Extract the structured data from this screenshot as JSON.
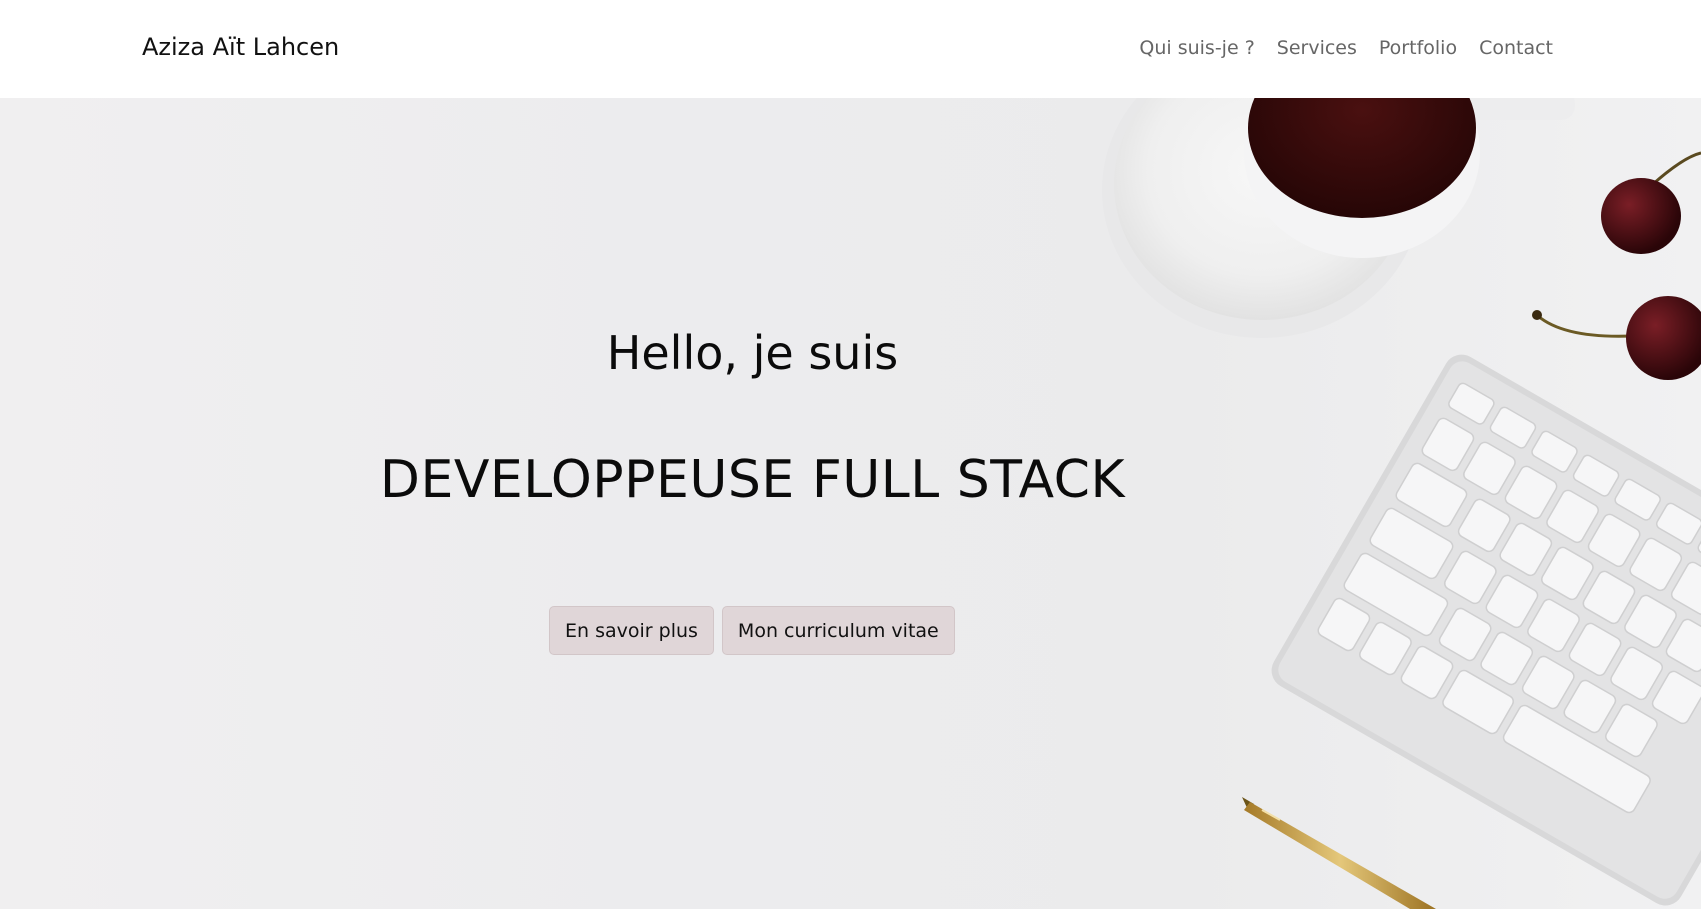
{
  "navbar": {
    "brand": "Aziza Aït Lahcen",
    "links": [
      "Qui suis-je ?",
      "Services",
      "Portfolio",
      "Contact"
    ]
  },
  "hero": {
    "greeting": "Hello, je suis",
    "title": "DEVELOPPEUSE FULL STACK",
    "buttons": [
      "En savoir plus",
      "Mon curriculum vitae"
    ],
    "image_contents": [
      "coffee-cup",
      "cherries",
      "keyboard",
      "pen"
    ]
  },
  "colors": {
    "button_bg": "#e0d6d8",
    "hero_bg": "#ececee",
    "coffee": "#3e0c0c",
    "pen_gold": "#c9a24a"
  }
}
